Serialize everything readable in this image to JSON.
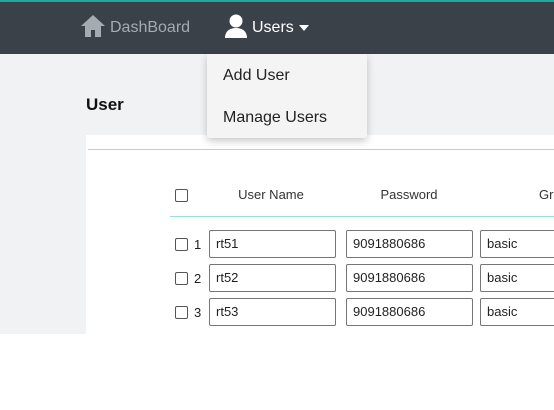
{
  "nav": {
    "dashboard_label": "DashBoard",
    "users_label": "Users"
  },
  "users_menu": {
    "items": [
      {
        "label": "Add User"
      },
      {
        "label": "Manage Users"
      }
    ]
  },
  "page": {
    "title": "User"
  },
  "table": {
    "columns": [
      "User Name",
      "Password",
      "Gr"
    ],
    "rows": [
      {
        "num": "1",
        "username": "rt51",
        "password": "9091880686",
        "group": "basic"
      },
      {
        "num": "2",
        "username": "rt52",
        "password": "9091880686",
        "group": "basic"
      },
      {
        "num": "3",
        "username": "rt53",
        "password": "9091880686",
        "group": "basic"
      }
    ]
  },
  "colors": {
    "topbar": "#3a4149",
    "accent": "#23a89e",
    "content_bg": "#f1f2f4"
  },
  "icons": {
    "dashboard": "home-icon",
    "users": "user-icon",
    "dropdown": "caret-down-icon"
  }
}
